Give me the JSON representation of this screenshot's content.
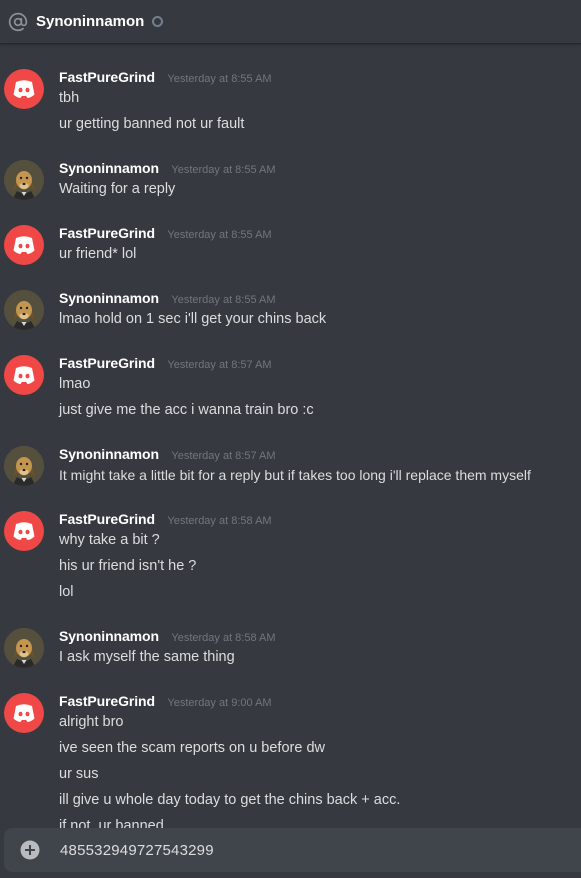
{
  "header": {
    "recipient": "Synoninnamon",
    "status": "offline"
  },
  "users": {
    "a": {
      "name": "FastPureGrind",
      "avatar": "discord-logo"
    },
    "b": {
      "name": "Synoninnamon",
      "avatar": "dog-portrait"
    }
  },
  "messages": [
    {
      "user": "FastPureGrind",
      "time": "Yesterday at 8:55 AM",
      "lines": [
        "tbh",
        "ur getting banned not ur fault"
      ]
    },
    {
      "user": "Synoninnamon",
      "time": "Yesterday at 8:55 AM",
      "lines": [
        "Waiting for a reply"
      ]
    },
    {
      "user": "FastPureGrind",
      "time": "Yesterday at 8:55 AM",
      "lines": [
        "ur friend* lol"
      ]
    },
    {
      "user": "Synoninnamon",
      "time": "Yesterday at 8:55 AM",
      "lines": [
        "lmao hold on 1 sec i'll get your chins back"
      ]
    },
    {
      "user": "FastPureGrind",
      "time": "Yesterday at 8:57 AM",
      "lines": [
        "lmao",
        "just give me the acc i wanna train bro :c"
      ]
    },
    {
      "user": "Synoninnamon",
      "time": "Yesterday at 8:57 AM",
      "lines": [
        "It might take a little bit for a reply but if takes too long i'll replace them myself"
      ]
    },
    {
      "user": "FastPureGrind",
      "time": "Yesterday at 8:58 AM",
      "lines": [
        "why take a bit ?",
        "his ur friend isn't he ?",
        "lol"
      ]
    },
    {
      "user": "Synoninnamon",
      "time": "Yesterday at 8:58 AM",
      "lines": [
        "I ask myself the same thing"
      ]
    },
    {
      "user": "FastPureGrind",
      "time": "Yesterday at 9:00 AM",
      "lines": [
        "alright bro",
        "ive seen the scam reports on u before dw",
        "ur sus",
        "ill give u whole day today to get the chins back + acc.",
        "if not, ur banned"
      ]
    }
  ],
  "composer": {
    "value": "485532949727543299"
  },
  "colors": {
    "background": "#36393f",
    "composer": "#40444b",
    "discord_red": "#f04747",
    "username": "#ffffff",
    "text": "#dcddde",
    "timestamp": "#72767d"
  },
  "icons": {
    "mention": "at-sign-icon",
    "status": "status-dot-icon",
    "attach": "plus-circle-icon"
  }
}
